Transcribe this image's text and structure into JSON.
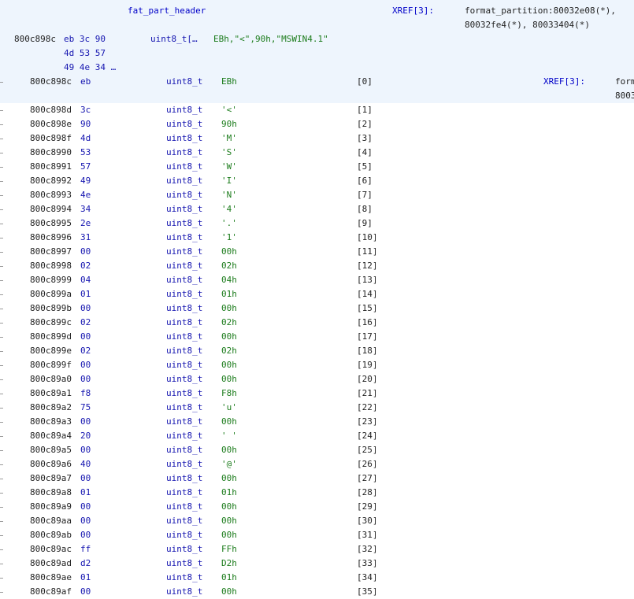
{
  "header": {
    "label": "fat_part_header",
    "xref_label": "XREF[3]:",
    "xref_line1": "format_partition:80032e08(*),",
    "xref_line2": "80032fe4(*), 80033404(*)",
    "struct_addr": "800c898c",
    "struct_bytes_1": "eb 3c 90",
    "struct_bytes_2": "4d 53 57",
    "struct_bytes_3": "49 4e 34 …",
    "struct_type": "uint8_t[…",
    "struct_value": "EBh,\"<\",90h,\"MSWIN4.1\"",
    "first_addr": "800c898c",
    "first_byte": "eb",
    "first_type": "uint8_t",
    "first_value": "EBh",
    "first_index": "[0]",
    "first_xref_label": "XREF[3]:",
    "first_xref_1": "form",
    "first_xref_2": "8003"
  },
  "rows": [
    {
      "addr": "800c898d",
      "byte": "3c",
      "type": "uint8_t",
      "value": "'<'",
      "index": "[1]"
    },
    {
      "addr": "800c898e",
      "byte": "90",
      "type": "uint8_t",
      "value": "90h",
      "index": "[2]"
    },
    {
      "addr": "800c898f",
      "byte": "4d",
      "type": "uint8_t",
      "value": "'M'",
      "index": "[3]"
    },
    {
      "addr": "800c8990",
      "byte": "53",
      "type": "uint8_t",
      "value": "'S'",
      "index": "[4]"
    },
    {
      "addr": "800c8991",
      "byte": "57",
      "type": "uint8_t",
      "value": "'W'",
      "index": "[5]"
    },
    {
      "addr": "800c8992",
      "byte": "49",
      "type": "uint8_t",
      "value": "'I'",
      "index": "[6]"
    },
    {
      "addr": "800c8993",
      "byte": "4e",
      "type": "uint8_t",
      "value": "'N'",
      "index": "[7]"
    },
    {
      "addr": "800c8994",
      "byte": "34",
      "type": "uint8_t",
      "value": "'4'",
      "index": "[8]"
    },
    {
      "addr": "800c8995",
      "byte": "2e",
      "type": "uint8_t",
      "value": "'.'",
      "index": "[9]"
    },
    {
      "addr": "800c8996",
      "byte": "31",
      "type": "uint8_t",
      "value": "'1'",
      "index": "[10]"
    },
    {
      "addr": "800c8997",
      "byte": "00",
      "type": "uint8_t",
      "value": "00h",
      "index": "[11]"
    },
    {
      "addr": "800c8998",
      "byte": "02",
      "type": "uint8_t",
      "value": "02h",
      "index": "[12]"
    },
    {
      "addr": "800c8999",
      "byte": "04",
      "type": "uint8_t",
      "value": "04h",
      "index": "[13]"
    },
    {
      "addr": "800c899a",
      "byte": "01",
      "type": "uint8_t",
      "value": "01h",
      "index": "[14]"
    },
    {
      "addr": "800c899b",
      "byte": "00",
      "type": "uint8_t",
      "value": "00h",
      "index": "[15]"
    },
    {
      "addr": "800c899c",
      "byte": "02",
      "type": "uint8_t",
      "value": "02h",
      "index": "[16]"
    },
    {
      "addr": "800c899d",
      "byte": "00",
      "type": "uint8_t",
      "value": "00h",
      "index": "[17]"
    },
    {
      "addr": "800c899e",
      "byte": "02",
      "type": "uint8_t",
      "value": "02h",
      "index": "[18]"
    },
    {
      "addr": "800c899f",
      "byte": "00",
      "type": "uint8_t",
      "value": "00h",
      "index": "[19]"
    },
    {
      "addr": "800c89a0",
      "byte": "00",
      "type": "uint8_t",
      "value": "00h",
      "index": "[20]"
    },
    {
      "addr": "800c89a1",
      "byte": "f8",
      "type": "uint8_t",
      "value": "F8h",
      "index": "[21]"
    },
    {
      "addr": "800c89a2",
      "byte": "75",
      "type": "uint8_t",
      "value": "'u'",
      "index": "[22]"
    },
    {
      "addr": "800c89a3",
      "byte": "00",
      "type": "uint8_t",
      "value": "00h",
      "index": "[23]"
    },
    {
      "addr": "800c89a4",
      "byte": "20",
      "type": "uint8_t",
      "value": "' '",
      "index": "[24]"
    },
    {
      "addr": "800c89a5",
      "byte": "00",
      "type": "uint8_t",
      "value": "00h",
      "index": "[25]"
    },
    {
      "addr": "800c89a6",
      "byte": "40",
      "type": "uint8_t",
      "value": "'@'",
      "index": "[26]"
    },
    {
      "addr": "800c89a7",
      "byte": "00",
      "type": "uint8_t",
      "value": "00h",
      "index": "[27]"
    },
    {
      "addr": "800c89a8",
      "byte": "01",
      "type": "uint8_t",
      "value": "01h",
      "index": "[28]"
    },
    {
      "addr": "800c89a9",
      "byte": "00",
      "type": "uint8_t",
      "value": "00h",
      "index": "[29]"
    },
    {
      "addr": "800c89aa",
      "byte": "00",
      "type": "uint8_t",
      "value": "00h",
      "index": "[30]"
    },
    {
      "addr": "800c89ab",
      "byte": "00",
      "type": "uint8_t",
      "value": "00h",
      "index": "[31]"
    },
    {
      "addr": "800c89ac",
      "byte": "ff",
      "type": "uint8_t",
      "value": "FFh",
      "index": "[32]"
    },
    {
      "addr": "800c89ad",
      "byte": "d2",
      "type": "uint8_t",
      "value": "D2h",
      "index": "[33]"
    },
    {
      "addr": "800c89ae",
      "byte": "01",
      "type": "uint8_t",
      "value": "01h",
      "index": "[34]"
    },
    {
      "addr": "800c89af",
      "byte": "00",
      "type": "uint8_t",
      "value": "00h",
      "index": "[35]"
    }
  ]
}
